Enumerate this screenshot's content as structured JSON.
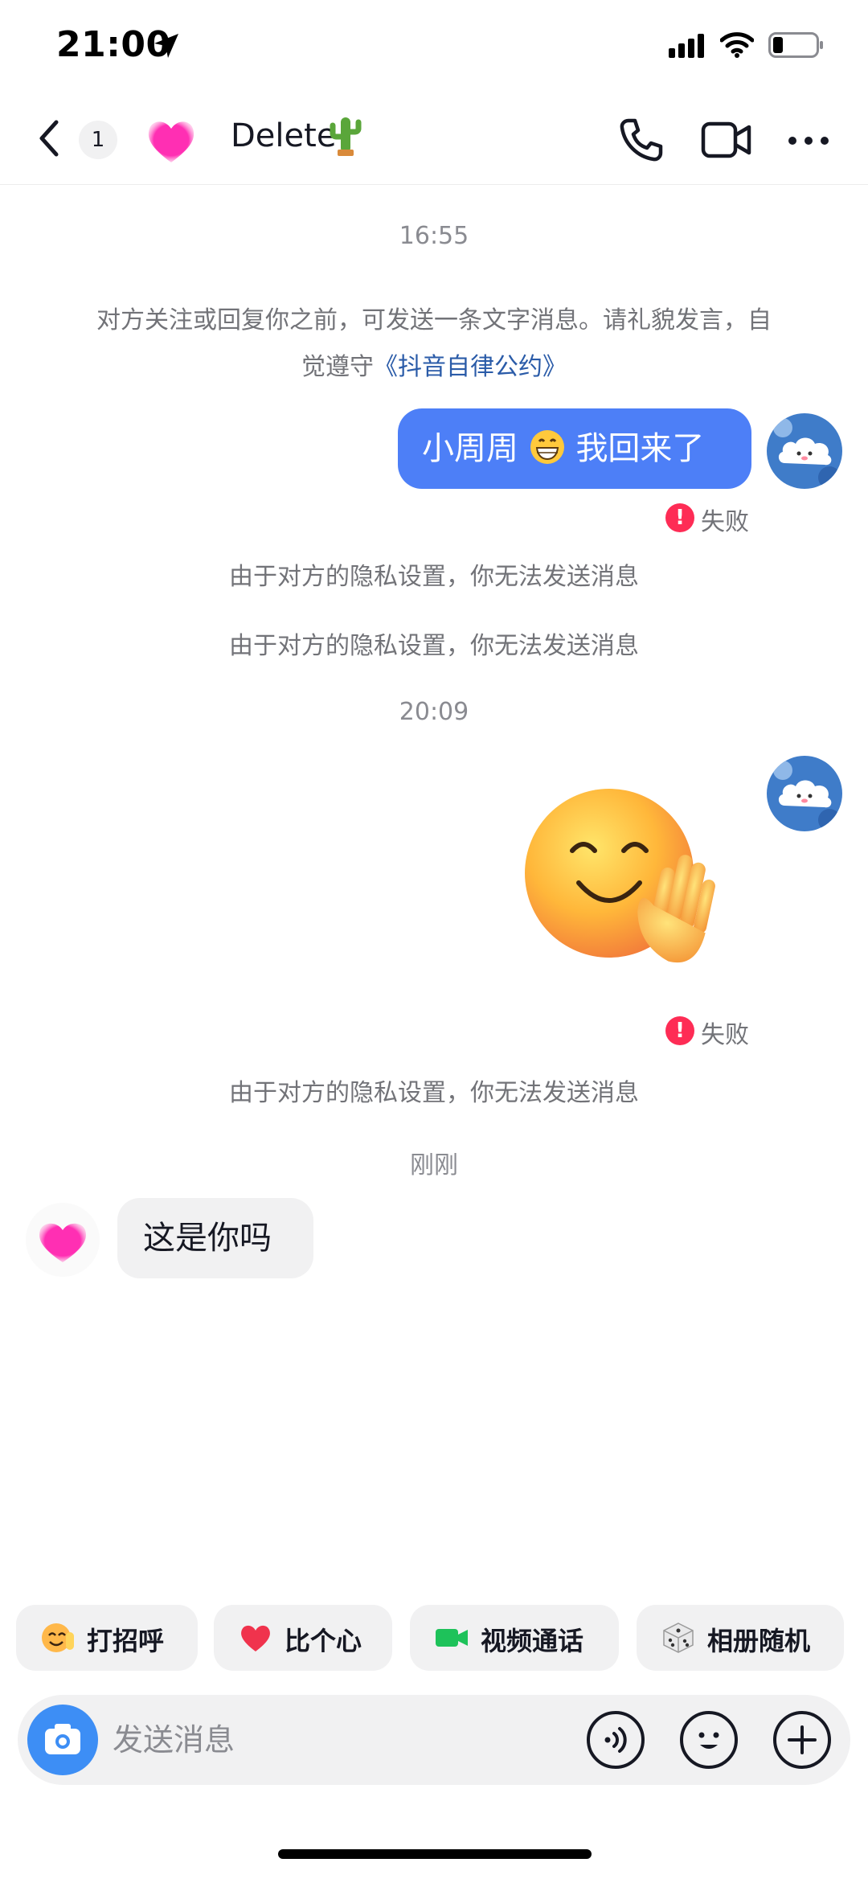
{
  "status_bar": {
    "time": "21:00"
  },
  "header": {
    "unread_count": "1",
    "contact_name": "Delete",
    "contact_name_emoji": "cactus-emoji"
  },
  "chat": {
    "timestamp_1": "16:55",
    "notice_text": "对方关注或回复你之前，可发送一条文字消息。请礼貌发言，自觉遵守",
    "notice_link": "《抖音自律公约》",
    "outgoing_message_prefix": "小周周",
    "outgoing_message_suffix": "我回来了",
    "failed_label": "失败",
    "privacy_notice": "由于对方的隐私设置，你无法发送消息",
    "timestamp_2": "20:09",
    "timestamp_3": "刚刚",
    "incoming_message": "这是你吗"
  },
  "quick_actions": [
    {
      "label": "打招呼",
      "icon": "wave-emoji"
    },
    {
      "label": "比个心",
      "icon": "heart-emoji"
    },
    {
      "label": "视频通话",
      "icon": "video-camera-icon"
    },
    {
      "label": "相册随机",
      "icon": "dice-emoji"
    }
  ],
  "input": {
    "placeholder": "发送消息"
  },
  "colors": {
    "accent": "#4d7ff7",
    "link": "#2a5ba8",
    "error": "#fe2c55",
    "camera": "#3d8ef5",
    "bubble_in": "#f1f1f2"
  }
}
